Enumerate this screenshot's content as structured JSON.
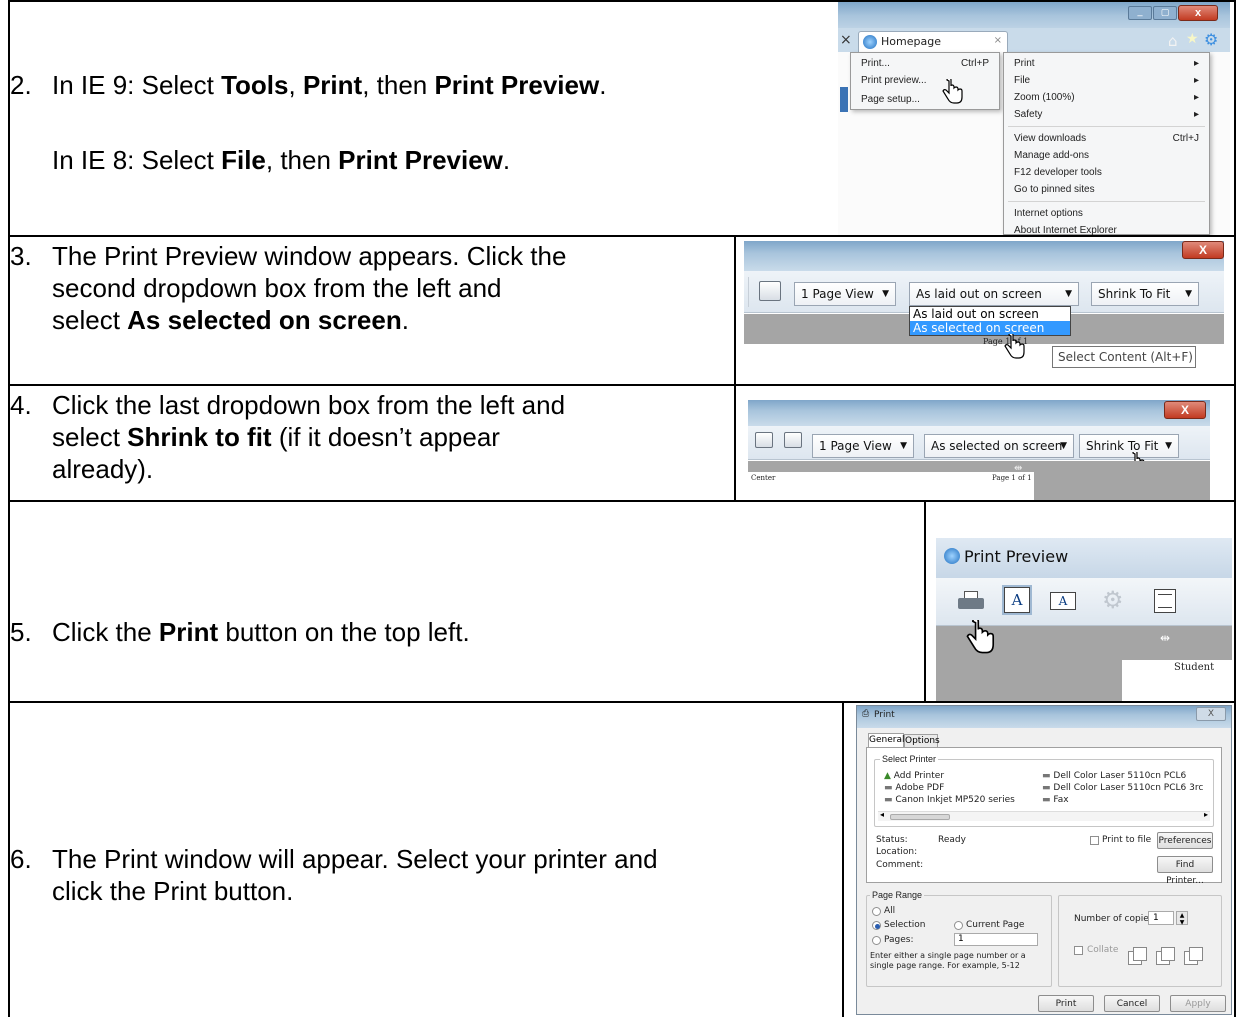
{
  "step2": {
    "num": "2.",
    "line1_pre": "In IE 9: Select ",
    "line1_b1": "Tools",
    "line1_sep1": ", ",
    "line1_b2": "Print",
    "line1_sep2": ", then ",
    "line1_b3": "Print Preview",
    "line1_end": ".",
    "line2_pre": "In IE 8: Select ",
    "line2_b1": "File",
    "line2_sep": ", then ",
    "line2_b2": "Print Preview",
    "line2_end": ".",
    "shot": {
      "tab_label": "Homepage",
      "tab_close": "×",
      "submenu": [
        {
          "label": "Print...",
          "shortcut": "Ctrl+P"
        },
        {
          "label": "Print preview...",
          "shortcut": ""
        },
        {
          "label": "Page setup...",
          "shortcut": ""
        }
      ],
      "tools_menu_group1": [
        {
          "label": "Print",
          "arrow": "▸"
        },
        {
          "label": "File",
          "arrow": "▸"
        },
        {
          "label": "Zoom (100%)",
          "arrow": "▸"
        },
        {
          "label": "Safety",
          "arrow": "▸"
        }
      ],
      "tools_menu_group2": [
        {
          "label": "View downloads",
          "shortcut": "Ctrl+J"
        },
        {
          "label": "Manage add-ons",
          "shortcut": ""
        },
        {
          "label": "F12 developer tools",
          "shortcut": ""
        },
        {
          "label": "Go to pinned sites",
          "shortcut": ""
        }
      ],
      "tools_menu_group3": [
        {
          "label": "Internet options"
        },
        {
          "label": "About Internet Explorer"
        }
      ]
    }
  },
  "step3": {
    "num": "3.",
    "line1": "The Print Preview window appears. Click the",
    "line2": "second dropdown box from the left and",
    "line3_pre": "select ",
    "line3_b": "As selected on screen",
    "line3_end": ".",
    "shot": {
      "combo1": "1 Page View",
      "combo2": "As laid out on screen",
      "combo3": "Shrink To Fit",
      "option1": "As laid out on screen",
      "option2": "As selected on screen",
      "page_label": "Page 1 of 1",
      "tooltip": "Select Content (Alt+F)",
      "close": "X"
    }
  },
  "step4": {
    "num": "4.",
    "line1": "Click the last dropdown box from the left and",
    "line2_pre": "select ",
    "line2_b": "Shrink to fit",
    "line2_end": " (if it doesn’t appear",
    "line3": "already).",
    "shot": {
      "combo1": "1 Page View",
      "combo2": "As selected on screen",
      "combo3": "Shrink To Fit",
      "page_left": "Center",
      "page_label": "Page 1 of 1",
      "close": "X"
    }
  },
  "step5": {
    "num": "5.",
    "line_pre": "Click the ",
    "line_b": "Print",
    "line_end": " button on the top left.",
    "shot": {
      "title": "Print Preview",
      "page_text": "Student"
    }
  },
  "step6": {
    "num": "6.",
    "line1": "The Print window will appear. Select your printer and",
    "line2": "click the Print button.",
    "shot": {
      "title": "Print",
      "tab_general": "General",
      "tab_options": "Options",
      "select_printer": "Select Printer",
      "printers_left": [
        "Add Printer",
        "Adobe PDF",
        "Canon Inkjet MP520 series"
      ],
      "printers_right": [
        "Dell Color Laser 5110cn PCL6",
        "Dell Color Laser 5110cn PCL6 3rc",
        "Fax"
      ],
      "status_label": "Status:",
      "status_value": "Ready",
      "location_label": "Location:",
      "comment_label": "Comment:",
      "print_to_file": "Print to file",
      "preferences": "Preferences",
      "find_printer": "Find Printer...",
      "page_range": "Page Range",
      "all": "All",
      "selection": "Selection",
      "current_page": "Current Page",
      "pages": "Pages:",
      "pages_value": "1",
      "hint": "Enter either a single page number or a single page range. For example, 5-12",
      "copies_label": "Number of copies:",
      "copies_value": "1",
      "collate": "Collate",
      "print_btn": "Print",
      "cancel_btn": "Cancel",
      "apply_btn": "Apply"
    }
  }
}
